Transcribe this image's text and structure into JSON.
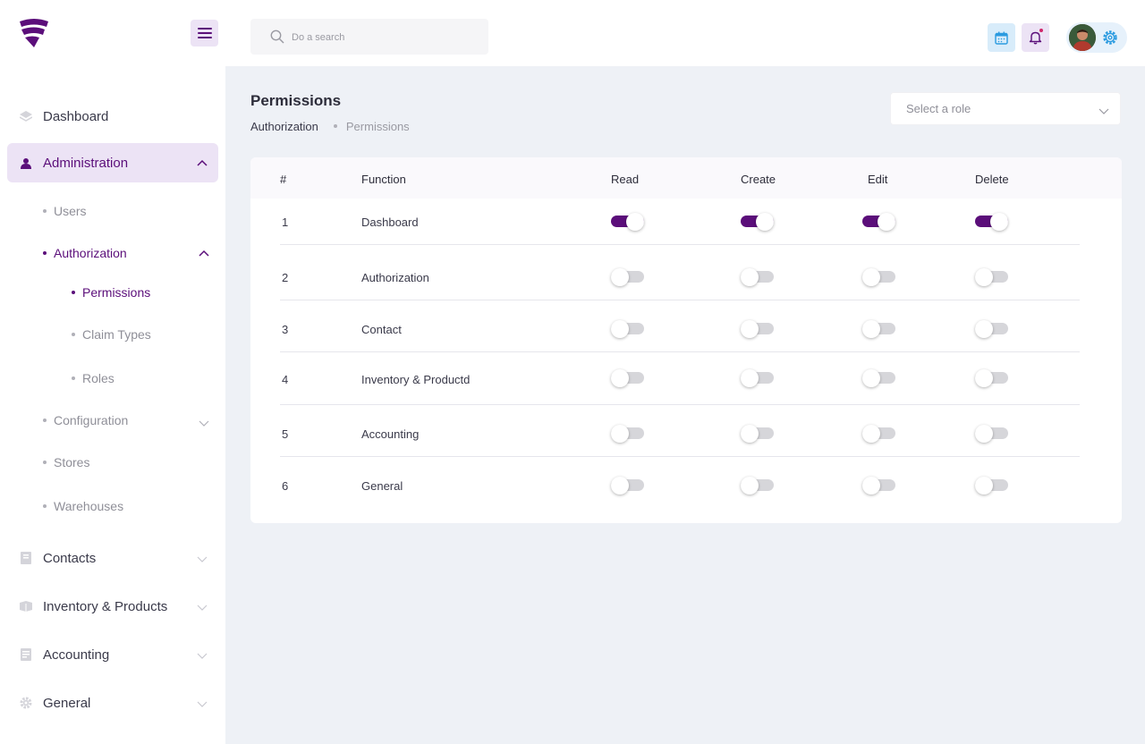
{
  "colors": {
    "accent": "#5b0e7a",
    "accent_light": "#ece3f5",
    "page_bg": "#eef1f6",
    "info_light": "#d8ecfa"
  },
  "search": {
    "placeholder": "Do a search"
  },
  "sidebar": {
    "dashboard": "Dashboard",
    "administration": "Administration",
    "users": "Users",
    "authorization": "Authorization",
    "permissions": "Permissions",
    "claim_types": "Claim Types",
    "roles": "Roles",
    "configuration": "Configuration",
    "stores": "Stores",
    "warehouses": "Warehouses",
    "contacts": "Contacts",
    "inventory": "Inventory & Products",
    "accounting": "Accounting",
    "general": "General"
  },
  "page": {
    "title": "Permissions",
    "breadcrumb": [
      "Authorization",
      "Permissions"
    ],
    "role_select_placeholder": "Select a role"
  },
  "table": {
    "columns": [
      "#",
      "Function",
      "Read",
      "Create",
      "Edit",
      "Delete"
    ],
    "rows": [
      {
        "num": "1",
        "function": "Dashboard",
        "read": true,
        "create": true,
        "edit": true,
        "delete": true
      },
      {
        "num": "2",
        "function": "Authorization",
        "read": false,
        "create": false,
        "edit": false,
        "delete": false
      },
      {
        "num": "3",
        "function": "Contact",
        "read": false,
        "create": false,
        "edit": false,
        "delete": false
      },
      {
        "num": "4",
        "function": "Inventory & Productd",
        "read": false,
        "create": false,
        "edit": false,
        "delete": false
      },
      {
        "num": "5",
        "function": "Accounting",
        "read": false,
        "create": false,
        "edit": false,
        "delete": false
      },
      {
        "num": "6",
        "function": "General",
        "read": false,
        "create": false,
        "edit": false,
        "delete": false
      }
    ]
  }
}
